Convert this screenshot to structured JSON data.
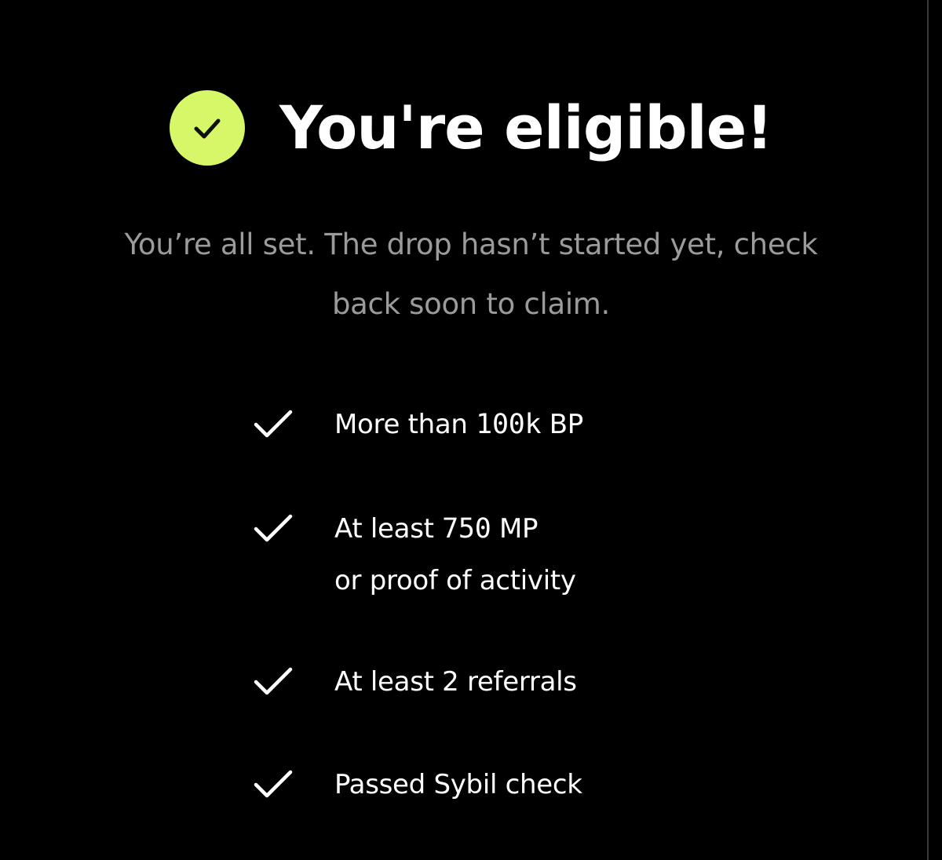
{
  "theme": {
    "background": "#000000",
    "accent": "#d5f768",
    "text": "#ffffff",
    "muted": "#9b9b9b"
  },
  "header": {
    "icon": "check-circle-icon",
    "title": "You're eligible!"
  },
  "subtitle": {
    "line1": "You’re all set. The drop hasn’t started yet, check",
    "line2": "back soon to claim."
  },
  "requirements": [
    {
      "icon": "checkmark-icon",
      "prefix": "More than ",
      "value": "100k",
      "suffix": " BP",
      "line2": ""
    },
    {
      "icon": "checkmark-icon",
      "prefix": "At least ",
      "value": "750",
      "suffix": " MP",
      "line2": "or proof of activity"
    },
    {
      "icon": "checkmark-icon",
      "prefix": "At least 2 referrals",
      "value": "",
      "suffix": "",
      "line2": ""
    },
    {
      "icon": "checkmark-icon",
      "prefix": "Passed Sybil check",
      "value": "",
      "suffix": "",
      "line2": ""
    }
  ]
}
